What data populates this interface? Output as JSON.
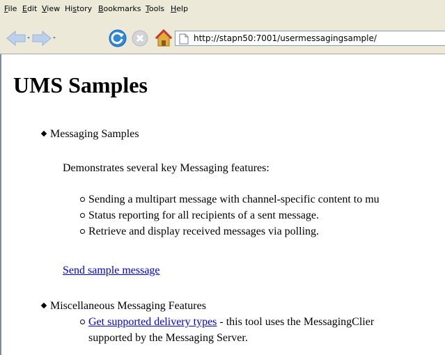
{
  "menu": {
    "file": "File",
    "edit": "Edit",
    "view": "View",
    "history": "History",
    "bookmarks": "Bookmarks",
    "tools": "Tools",
    "help": "Help"
  },
  "toolbar": {
    "url": "http://stapn50:7001/usermessagingsample/"
  },
  "page": {
    "title": "UMS Samples",
    "section1": {
      "label": "Messaging Samples",
      "intro": "Demonstrates several key Messaging features:",
      "features": [
        "Sending a multipart message with channel-specific content to mu",
        "Status reporting for all recipients of a sent message.",
        "Retrieve and display received messages via polling."
      ],
      "link": "Send sample message"
    },
    "section2": {
      "label": "Miscellaneous Messaging Features",
      "link": "Get supported delivery types",
      "desc": " - this tool uses the MessagingClier",
      "desc2": "supported by the Messaging Server."
    }
  },
  "colors": {
    "chrome": "#ece9d8",
    "link": "#0000ee",
    "arrow_disabled": "#bdd0ea",
    "reload": "#2e8ad8",
    "home": "#e0ae3c"
  }
}
